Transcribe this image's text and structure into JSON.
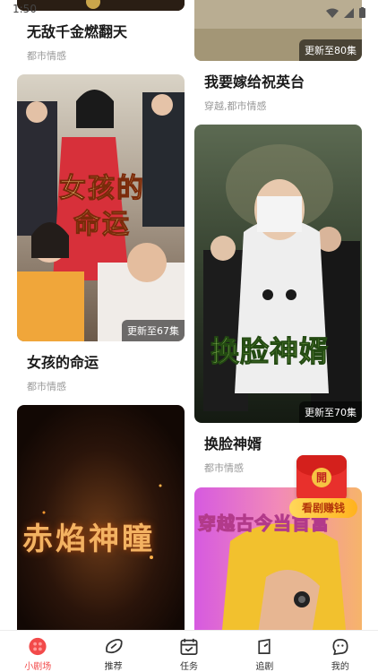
{
  "status": {
    "time": "1:50"
  },
  "feed": {
    "left": [
      {
        "title": "无敌千金燃翻天",
        "tag": "都市情感"
      },
      {
        "title": "女孩的命运",
        "tag": "都市情感",
        "badge": "更新至67集",
        "overlay": "女孩的命运"
      },
      {
        "title": "",
        "tag": "",
        "overlay": "赤焰神瞳"
      }
    ],
    "right": [
      {
        "title": "我要嫁给祝英台",
        "tag": "穿越,都市情感",
        "badge": "更新至80集"
      },
      {
        "title": "换脸神婿",
        "tag": "都市情感",
        "badge": "更新至70集",
        "overlay": "换脸神婿"
      },
      {
        "title": "",
        "tag": "",
        "overlay": "穿越古今当首富"
      }
    ]
  },
  "float_promo": {
    "seal": "開",
    "label": "看剧赚钱"
  },
  "tabbar": {
    "items": [
      {
        "label": "小剧场",
        "icon": "theater-icon",
        "active": true
      },
      {
        "label": "推荐",
        "icon": "recommend-icon",
        "active": false
      },
      {
        "label": "任务",
        "icon": "task-icon",
        "active": false
      },
      {
        "label": "追剧",
        "icon": "follow-icon",
        "active": false
      },
      {
        "label": "我的",
        "icon": "profile-icon",
        "active": false
      }
    ]
  },
  "colors": {
    "accent": "#f24a4a",
    "tag_gray": "#999999",
    "badge_bg": "rgba(0,0,0,0.55)"
  }
}
